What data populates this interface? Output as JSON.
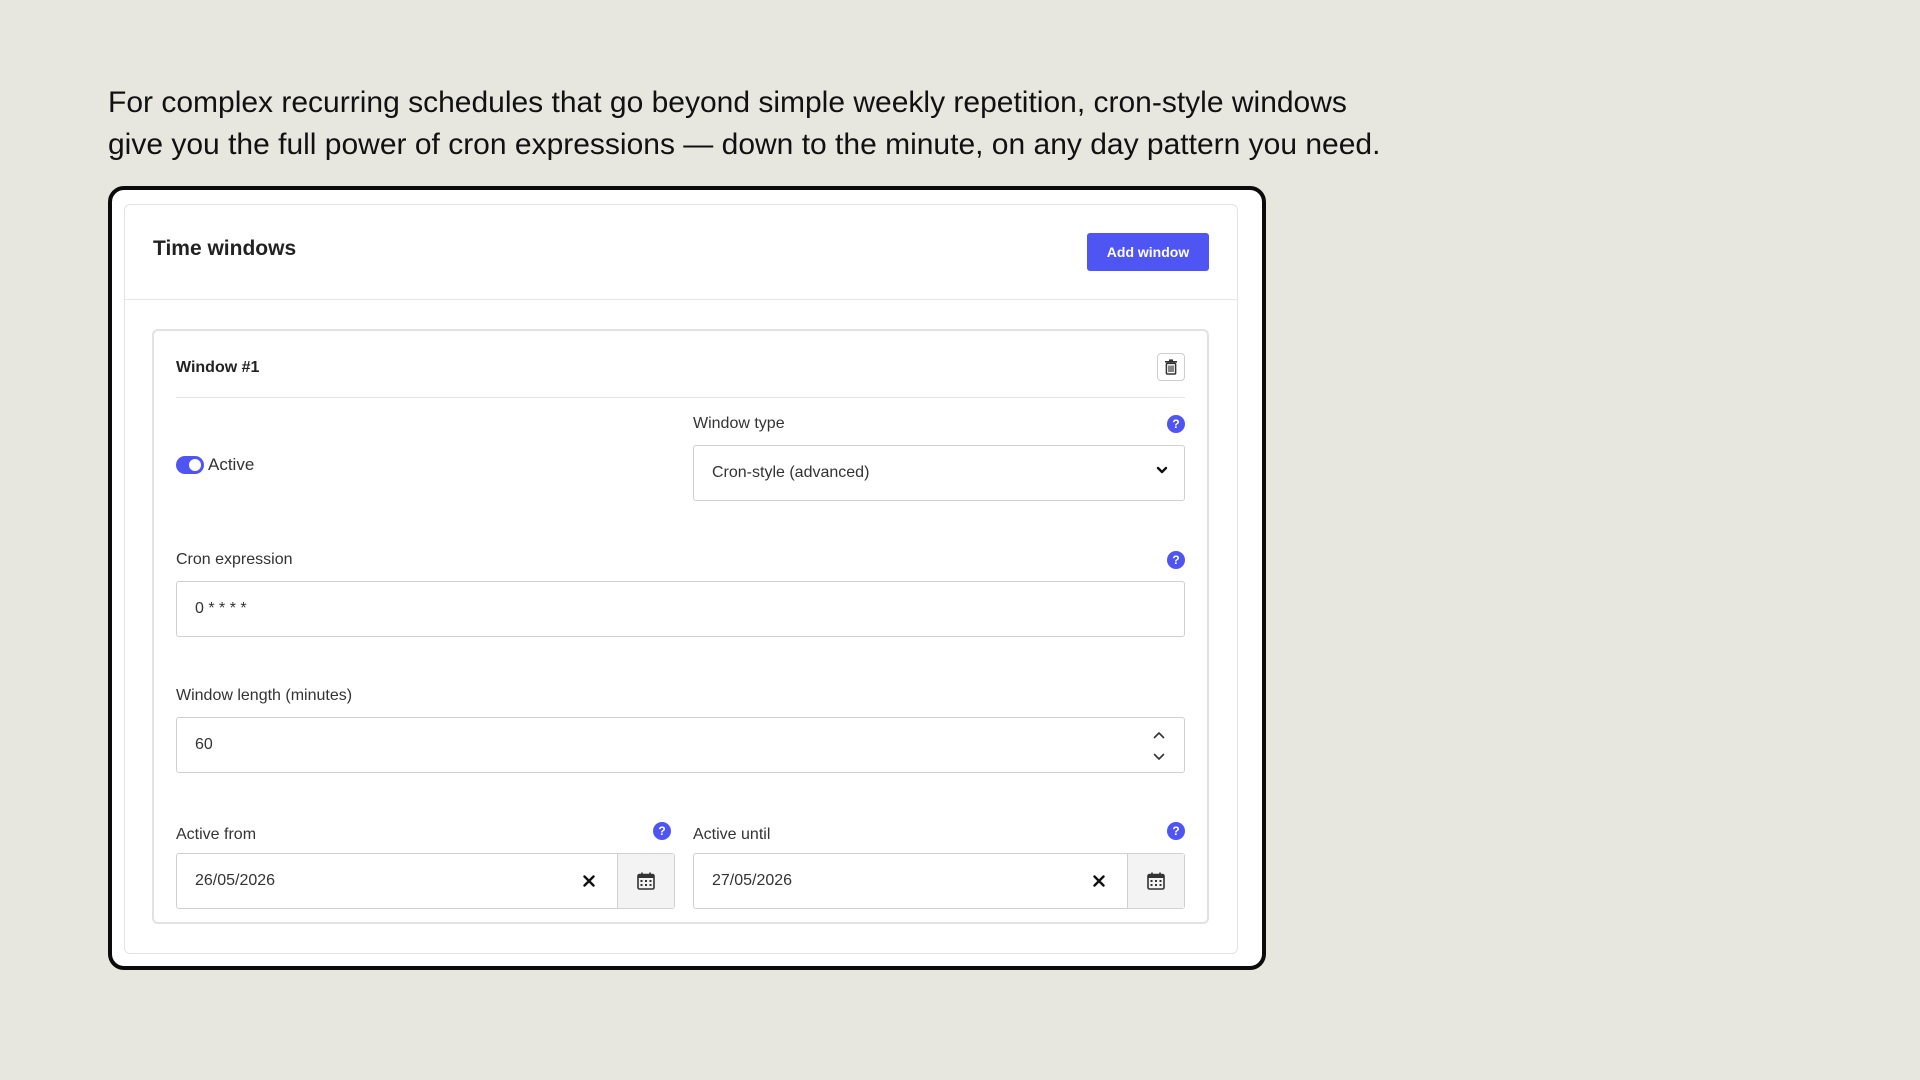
{
  "intro": {
    "line1": "For complex recurring schedules that go beyond simple weekly repetition, cron-style windows",
    "line2": "give you the full power of cron expressions — down to the minute, on any day pattern you need."
  },
  "panel": {
    "title": "Time windows",
    "add_button": "Add window"
  },
  "window": {
    "title": "Window #1",
    "delete_icon": "trash-icon",
    "active_toggle": {
      "label": "Active",
      "on": true
    },
    "window_type": {
      "label": "Window type",
      "value": "Cron-style (advanced)"
    },
    "cron": {
      "label": "Cron expression",
      "value": "0 * * * *"
    },
    "length": {
      "label": "Window length (minutes)",
      "value": "60"
    },
    "active_from": {
      "label": "Active from",
      "value": "26/05/2026"
    },
    "active_until": {
      "label": "Active until",
      "value": "27/05/2026"
    },
    "help_glyph": "?"
  },
  "colors": {
    "accent": "#4f55f2",
    "background": "#e7e7e0",
    "frame_border": "#0b0b0b"
  }
}
